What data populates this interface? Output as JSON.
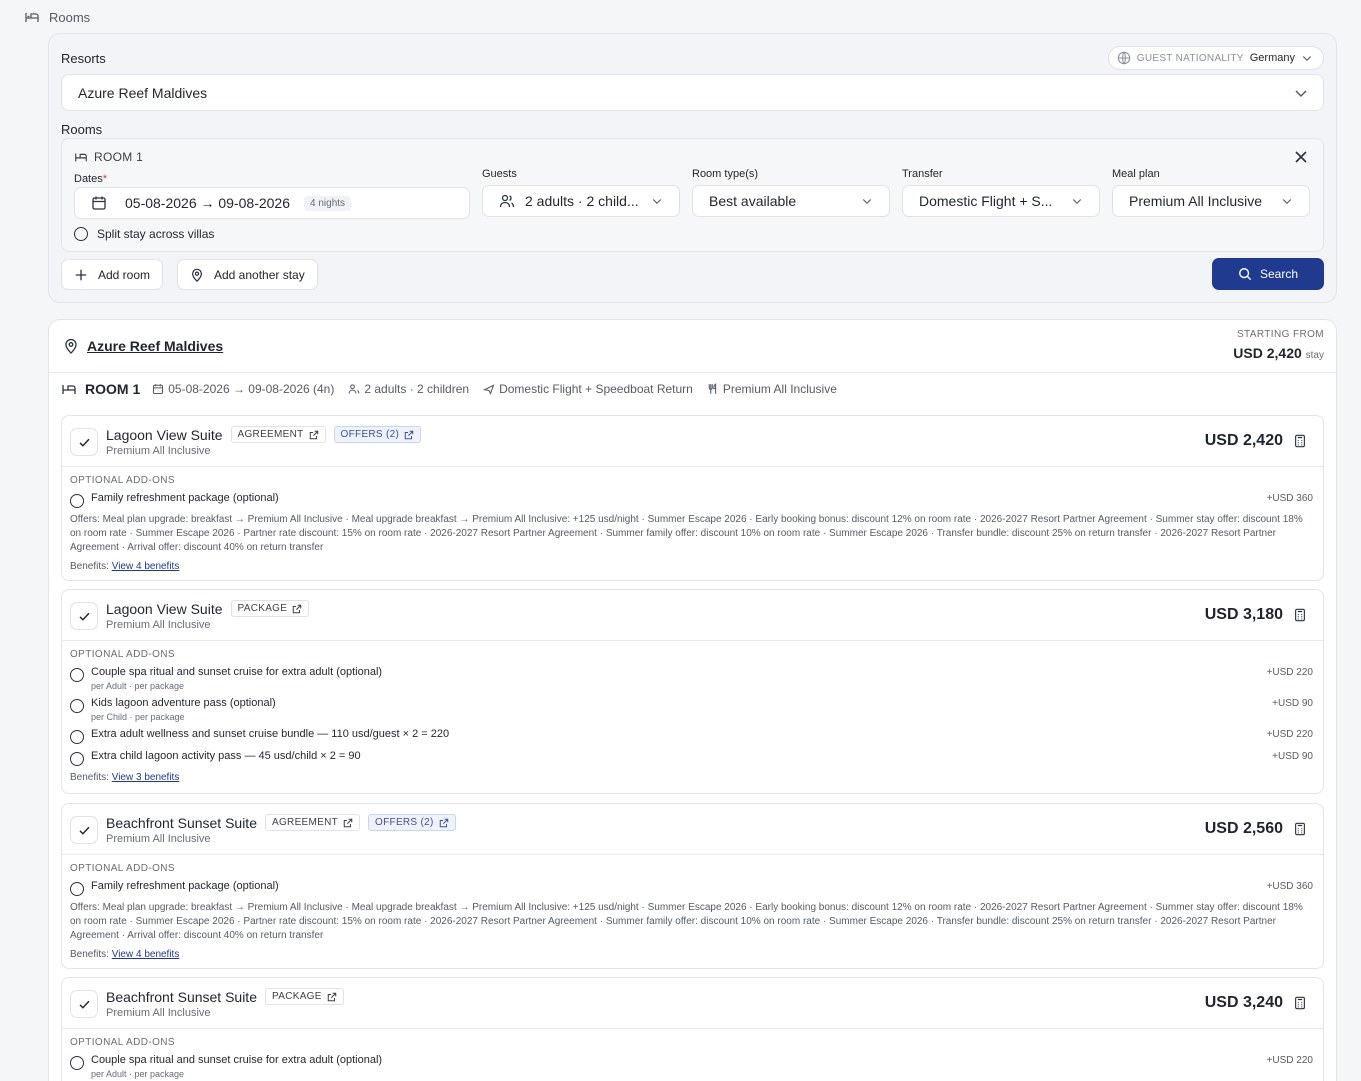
{
  "header": {
    "title": "Rooms"
  },
  "search": {
    "resorts_label": "Resorts",
    "nationality_label": "GUEST NATIONALITY",
    "nationality_value": "Germany",
    "resort_value": "Azure Reef Maldives",
    "rooms_label": "Rooms",
    "room_title": "ROOM 1",
    "dates_label": "Dates",
    "dates_required": "*",
    "dates_value": "05-08-2026 → 09-08-2026",
    "nights": "4 nights",
    "guests_label": "Guests",
    "guests_value": "2 adults · 2 child...",
    "roomtype_label": "Room type(s)",
    "roomtype_value": "Best available",
    "transfer_label": "Transfer",
    "transfer_value": "Domestic Flight + S...",
    "meal_label": "Meal plan",
    "meal_value": "Premium All Inclusive",
    "split_label": "Split stay across villas",
    "add_room": "Add room",
    "add_stay": "Add another stay",
    "search_button": "Search"
  },
  "result": {
    "resort_name": "Azure Reef Maldives",
    "starting_from": "STARTING FROM",
    "starting_price": "USD 2,420",
    "starting_suffix": "stay",
    "room_label": "ROOM 1",
    "dates": "05-08-2026 → 09-08-2026 (4n)",
    "guests": "2 adults · 2 children",
    "transfer": "Domestic Flight + Speedboat Return",
    "meal": "Premium All Inclusive",
    "addons_header": "OPTIONAL ADD-ONS",
    "benefits_prefix": "Benefits:",
    "offers_text": "Offers: Meal plan upgrade: breakfast → Premium All Inclusive · Meal upgrade breakfast → Premium All Inclusive: +125 usd/night · Summer Escape 2026 · Early booking bonus: discount 12% on room rate · 2026-2027 Resort Partner Agreement · Summer stay offer: discount 18% on room rate · Summer Escape 2026 · Partner rate discount: 15% on room rate · 2026-2027 Resort Partner Agreement · Summer family offer: discount 10% on room rate · Summer Escape 2026 · Transfer bundle: discount 25% on return transfer · 2026-2027 Resort Partner Agreement · Arrival offer: discount 40% on return transfer",
    "cards": [
      {
        "name": "Lagoon View Suite",
        "tag1": "AGREEMENT",
        "tag2": "OFFERS (2)",
        "meal": "Premium All Inclusive",
        "price": "USD 2,420",
        "addons": [
          {
            "label": "Family refreshment package (optional)",
            "price": "+USD 360"
          }
        ],
        "benefits": "View 4 benefits"
      },
      {
        "name": "Lagoon View Suite",
        "tag1": "PACKAGE",
        "meal": "Premium All Inclusive",
        "price": "USD 3,180",
        "addons": [
          {
            "label": "Couple spa ritual and sunset cruise for extra adult (optional)",
            "sub": "per Adult · per package",
            "price": "+USD 220"
          },
          {
            "label": "Kids lagoon adventure pass (optional)",
            "sub": "per Child · per package",
            "price": "+USD 90"
          },
          {
            "label": "Extra adult wellness and sunset cruise bundle — 110 usd/guest × 2 = 220",
            "price": "+USD 220"
          },
          {
            "label": "Extra child lagoon activity pass — 45 usd/child × 2 = 90",
            "price": "+USD 90"
          }
        ],
        "benefits": "View 3 benefits"
      },
      {
        "name": "Beachfront Sunset Suite",
        "tag1": "AGREEMENT",
        "tag2": "OFFERS (2)",
        "meal": "Premium All Inclusive",
        "price": "USD 2,560",
        "addons": [
          {
            "label": "Family refreshment package (optional)",
            "price": "+USD 360"
          }
        ],
        "benefits": "View 4 benefits"
      },
      {
        "name": "Beachfront Sunset Suite",
        "tag1": "PACKAGE",
        "meal": "Premium All Inclusive",
        "price": "USD 3,240",
        "addons": [
          {
            "label": "Couple spa ritual and sunset cruise for extra adult (optional)",
            "sub": "per Adult · per package",
            "price": "+USD 220"
          }
        ]
      }
    ]
  }
}
